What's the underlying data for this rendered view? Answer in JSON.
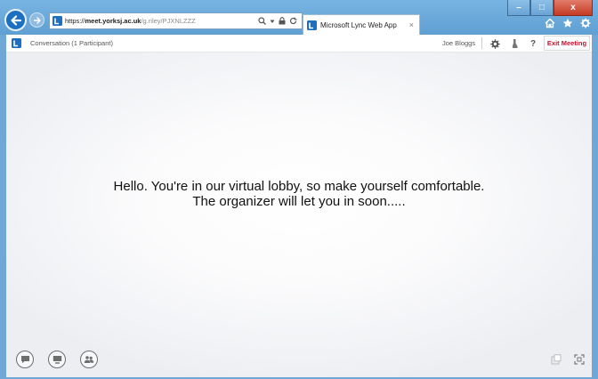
{
  "browser": {
    "url_scheme": "https://",
    "url_domain": "meet.yorksj.ac.uk",
    "url_path": "/g.riley/PJXNLZZZ",
    "tab_title": "Microsoft Lync Web App",
    "tab_close": "×",
    "window_buttons": {
      "minimize": "–",
      "maximize": "□",
      "close": "x"
    }
  },
  "app": {
    "conversation_title": "Conversation (1 Participant)",
    "user_name": "Joe Bloggs",
    "help_label": "?",
    "exit_label": "Exit Meeting",
    "lobby_line1": "Hello. You're in our virtual lobby, so make yourself comfortable.",
    "lobby_line2": "The organizer will let you in soon....."
  },
  "icons": {
    "nav": [
      "back-arrow-icon",
      "forward-arrow-icon"
    ],
    "header": [
      "settings-gear-icon",
      "device-icon",
      "help-icon"
    ],
    "bottom": [
      "im-chat-icon",
      "present-icon",
      "participants-icon"
    ],
    "bottom_right": [
      "popout-icon",
      "fullscreen-icon"
    ]
  },
  "colors": {
    "chrome": "#6fa8d6",
    "exit_red": "#c8102e",
    "lync_blue": "#1d6fc2"
  }
}
